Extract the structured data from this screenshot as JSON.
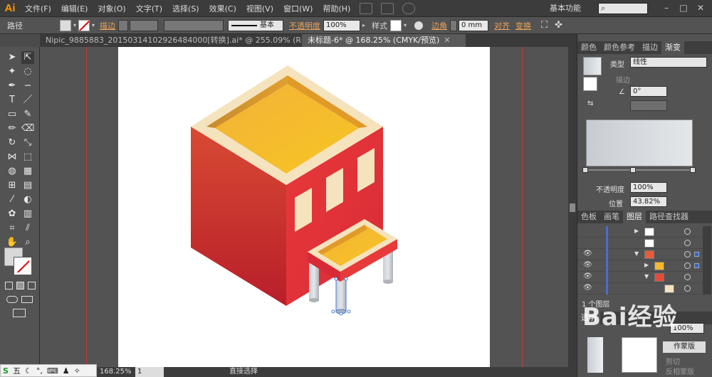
{
  "app": {
    "logo": "Ai"
  },
  "menu": [
    "文件(F)",
    "编辑(E)",
    "对象(O)",
    "文字(T)",
    "选择(S)",
    "效果(C)",
    "视图(V)",
    "窗口(W)",
    "帮助(H)"
  ],
  "workspace": {
    "label": "基本功能",
    "search_placeholder": ""
  },
  "control_bar": {
    "selection_label": "路径",
    "stroke_label": "描边",
    "stroke_style": "基本",
    "opacity_label": "不透明度",
    "opacity_value": "100%",
    "style_label": "样式",
    "corner_label": "边角",
    "corner_value": "0 mm",
    "align_label": "对齐",
    "transform_label": "变换"
  },
  "document_tabs": [
    {
      "label": "Nipic_9885883_20150314102926484000[转换].ai* @ 255.09% (RGB/预览)",
      "active": false
    },
    {
      "label": "未标题-6* @ 168.25% (CMYK/预览)",
      "active": true
    }
  ],
  "status_bar": {
    "zoom": "168.25%",
    "page": "1",
    "tool": "直接选择"
  },
  "color_panel": {
    "tabs": [
      "颜色",
      "颜色参考",
      "描边",
      "渐变"
    ],
    "active_tab": "渐变",
    "type_label": "类型",
    "type_value": "线性",
    "stroke_label": "描边",
    "angle_value": "0°",
    "opacity_label": "不透明度",
    "opacity_value": "100%",
    "position_label": "位置",
    "position_value": "43.82%"
  },
  "layers_panel": {
    "tabs": [
      "色板",
      "画笔",
      "图层",
      "路径查找器"
    ],
    "active_tab": "图层",
    "footer": "1 个图层"
  },
  "lower_panel": {
    "tabs": [
      "透明"
    ],
    "opacity_value": "100%",
    "mask_button": "作蒙版",
    "clip_label": "剪切",
    "invert_label": "反相蒙版"
  },
  "ime_bar": {
    "label": "五"
  },
  "watermark": "经验",
  "colors": {
    "building_red": "#d93a32",
    "roof_yellow": "#f4b92e",
    "trim_cream": "#f5e3be",
    "accent_orange": "#e8a35b",
    "guide_red": "#c43a3a"
  }
}
